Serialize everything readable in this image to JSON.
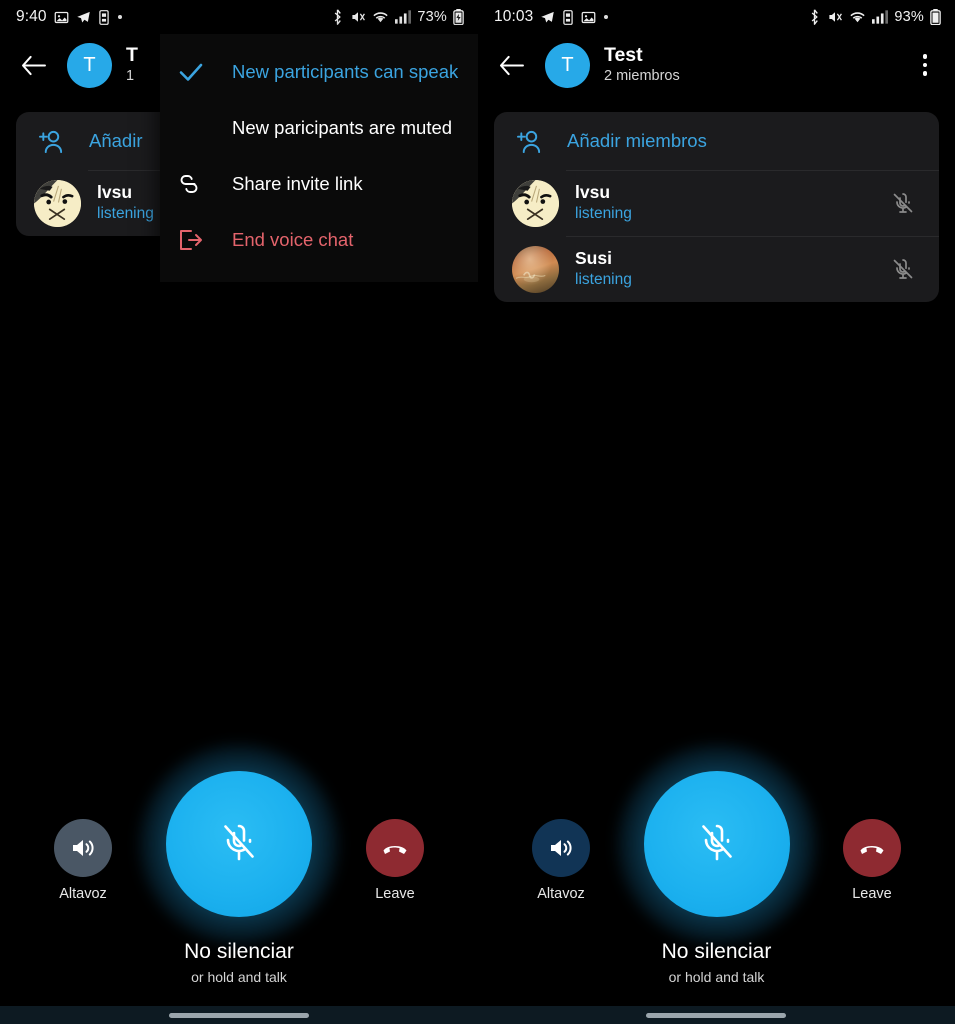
{
  "meta": {
    "accent_blue": "#3ba4e0",
    "mute_button_blue": "#1cb1ef",
    "danger_red": "#e4646c",
    "leave_red": "#8e2a31",
    "card_bg": "#1b1b1d",
    "page_bg": "#000000",
    "navbar_bg": "#0d1a22"
  },
  "left_panel": {
    "statusbar": {
      "clock": "9:40",
      "battery_percent": "73%",
      "left_icons": [
        "image-icon",
        "telegram-icon",
        "sd-card-icon",
        "dot-icon"
      ],
      "right_icons": [
        "bluetooth-icon",
        "mute-ringer-icon",
        "wifi-icon",
        "signal-icon",
        "battery-icon"
      ]
    },
    "appbar": {
      "back_icon": "back-arrow-icon",
      "avatar_initial": "T",
      "title": "T",
      "subtitle": "1",
      "overflow_icon": "overflow-menu-icon"
    },
    "members_card": {
      "add_members_label": "Añadir",
      "add_members_icon": "add-person-icon",
      "members": [
        {
          "name": "lvsu",
          "status": "listening",
          "avatar": "cartoon",
          "mic_icon": "mic-muted-icon"
        }
      ]
    },
    "popup_menu": {
      "items": [
        {
          "label": "New participants can speak",
          "icon": "check-icon",
          "style": "accent"
        },
        {
          "label": "New paricipants are muted",
          "icon": "none",
          "style": "neutral"
        },
        {
          "label": "Share invite link",
          "icon": "link-icon",
          "style": "neutral"
        },
        {
          "label": "End voice chat",
          "icon": "exit-icon",
          "style": "danger"
        }
      ]
    },
    "controls": {
      "speaker_label": "Altavoz",
      "speaker_icon": "speaker-icon",
      "speaker_variant": "grey",
      "mute_icon": "mic-muted-icon",
      "mute_title": "No silenciar",
      "mute_hint": "or hold and talk",
      "leave_label": "Leave",
      "leave_icon": "hangup-icon"
    }
  },
  "right_panel": {
    "statusbar": {
      "clock": "10:03",
      "battery_percent": "93%",
      "left_icons": [
        "telegram-icon",
        "sd-card-icon",
        "image-icon",
        "dot-icon"
      ],
      "right_icons": [
        "bluetooth-icon",
        "mute-ringer-icon",
        "wifi-icon",
        "signal-icon",
        "battery-icon"
      ]
    },
    "appbar": {
      "back_icon": "back-arrow-icon",
      "avatar_initial": "T",
      "title": "Test",
      "subtitle": "2 miembros",
      "overflow_icon": "overflow-menu-icon"
    },
    "members_card": {
      "add_members_label": "Añadir miembros",
      "add_members_icon": "add-person-icon",
      "members": [
        {
          "name": "lvsu",
          "status": "listening",
          "avatar": "cartoon",
          "mic_icon": "mic-muted-icon"
        },
        {
          "name": "Susi",
          "status": "listening",
          "avatar": "photo",
          "mic_icon": "mic-muted-icon"
        }
      ]
    },
    "controls": {
      "speaker_label": "Altavoz",
      "speaker_icon": "speaker-icon",
      "speaker_variant": "navy",
      "mute_icon": "mic-muted-icon",
      "mute_title": "No silenciar",
      "mute_hint": "or hold and talk",
      "leave_label": "Leave",
      "leave_icon": "hangup-icon"
    }
  }
}
